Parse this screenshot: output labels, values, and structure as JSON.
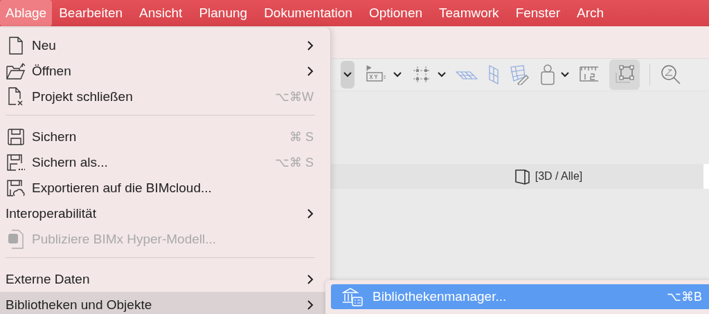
{
  "menubar": [
    {
      "label": "Ablage",
      "selected": true
    },
    {
      "label": "Bearbeiten",
      "selected": false
    },
    {
      "label": "Ansicht",
      "selected": false
    },
    {
      "label": "Planung",
      "selected": false
    },
    {
      "label": "Dokumentation",
      "selected": false
    },
    {
      "label": "Optionen",
      "selected": false
    },
    {
      "label": "Teamwork",
      "selected": false
    },
    {
      "label": "Fenster",
      "selected": false
    },
    {
      "label": "Arch",
      "selected": false
    }
  ],
  "view_tab": {
    "label": "[3D / Alle]"
  },
  "menu": {
    "items": [
      {
        "kind": "item",
        "label": "Neu",
        "submenu": true,
        "disabled": false,
        "selected": false
      },
      {
        "kind": "item",
        "label": "Öffnen",
        "submenu": true,
        "disabled": false,
        "selected": false
      },
      {
        "kind": "item",
        "label": "Projekt schließen",
        "shortcut": "⌥⌘W",
        "disabled": false,
        "selected": false
      },
      {
        "kind": "separator"
      },
      {
        "kind": "item",
        "label": "Sichern",
        "shortcut": "⌘ S",
        "disabled": false,
        "selected": false
      },
      {
        "kind": "item",
        "label": "Sichern als...",
        "shortcut": "⌥⌘ S",
        "disabled": false,
        "selected": false
      },
      {
        "kind": "item",
        "label": "Exportieren auf die BIMcloud...",
        "disabled": false,
        "selected": false
      },
      {
        "kind": "item",
        "label": "Interoperabilität",
        "submenu": true,
        "disabled": false,
        "selected": false
      },
      {
        "kind": "item",
        "label": "Publiziere BIMx Hyper-Modell...",
        "disabled": true,
        "selected": false
      },
      {
        "kind": "separator"
      },
      {
        "kind": "item",
        "label": "Externe Daten",
        "submenu": true,
        "disabled": false,
        "selected": false
      },
      {
        "kind": "item",
        "label": "Bibliotheken und Objekte",
        "submenu": true,
        "disabled": false,
        "selected": true
      }
    ]
  },
  "submenu": {
    "items": [
      {
        "label": "Bibliothekenmanager...",
        "shortcut": "⌥⌘B",
        "selected": true
      }
    ]
  }
}
